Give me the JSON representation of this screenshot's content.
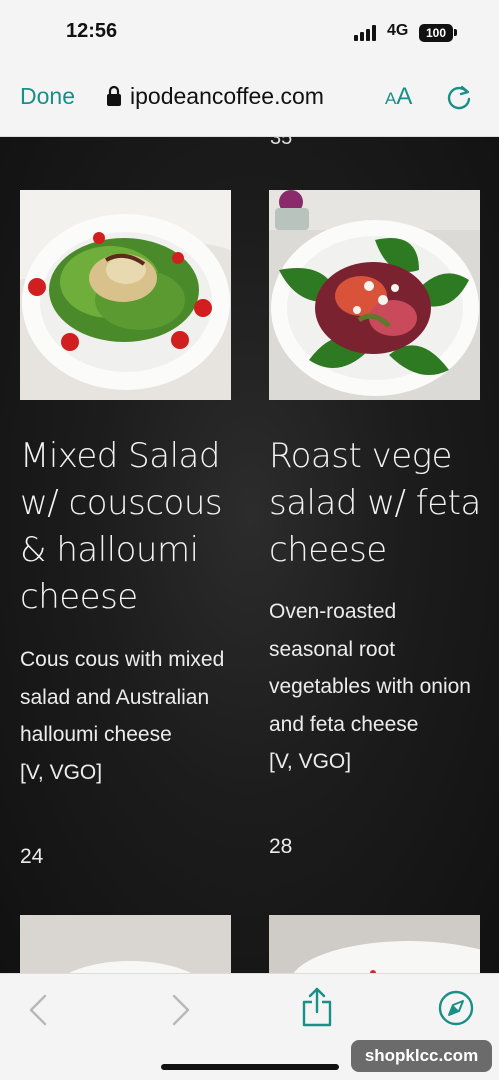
{
  "status_bar": {
    "time": "12:56",
    "network": "4G",
    "battery": "100"
  },
  "browser": {
    "done_label": "Done",
    "url": "ipodeancoffee.com",
    "text_size_small": "A",
    "text_size_large": "A"
  },
  "menu": {
    "cut_off_text": "35",
    "items": [
      {
        "title": "Mixed Salad w/ couscous & halloumi cheese",
        "description": "Cous cous with mixed salad and Australian halloumi cheese",
        "tags": "[V, VGO]",
        "price": "24"
      },
      {
        "title": "Roast vege salad w/ feta cheese",
        "description": "Oven-roasted seasonal root vegetables with onion and feta cheese",
        "tags": "[V, VGO]",
        "price": "28"
      }
    ]
  },
  "watermark": "shopklcc.com",
  "colors": {
    "accent": "#1a8f85",
    "background": "#1c1c1c",
    "chrome": "#f4f4f4"
  }
}
